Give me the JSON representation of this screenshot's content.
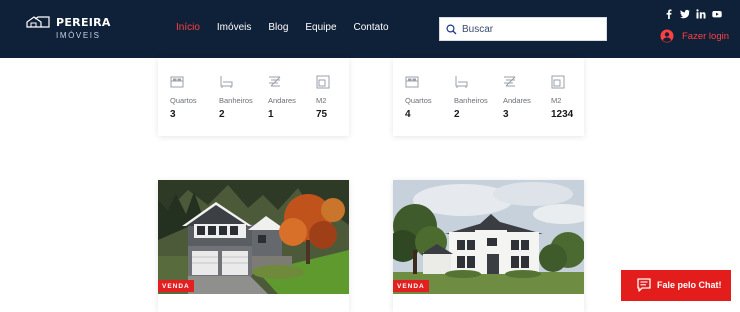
{
  "brand": {
    "name": "PEREIRA",
    "subtitle": "IMÓVEIS"
  },
  "nav": [
    {
      "label": "Início",
      "active": true
    },
    {
      "label": "Imóveis",
      "active": false
    },
    {
      "label": "Blog",
      "active": false
    },
    {
      "label": "Equipe",
      "active": false
    },
    {
      "label": "Contato",
      "active": false
    }
  ],
  "search": {
    "placeholder": "Buscar",
    "value": ""
  },
  "social": [
    "facebook-icon",
    "twitter-icon",
    "linkedin-icon",
    "youtube-icon"
  ],
  "login": {
    "label": "Fazer login",
    "icon": "user-icon"
  },
  "colors": {
    "header_bg": "#0f2039",
    "accent": "#ff4040",
    "badge": "#e32020",
    "chat": "#e31c1c"
  },
  "listings_top": [
    {
      "features": [
        {
          "label": "Quartos",
          "value": "3",
          "icon": "bed-icon"
        },
        {
          "label": "Banheiros",
          "value": "2",
          "icon": "bathtub-icon"
        },
        {
          "label": "Andares",
          "value": "1",
          "icon": "stairs-icon"
        },
        {
          "label": "M2",
          "value": "75",
          "icon": "area-icon"
        }
      ]
    },
    {
      "features": [
        {
          "label": "Quartos",
          "value": "4",
          "icon": "bed-icon"
        },
        {
          "label": "Banheiros",
          "value": "2",
          "icon": "bathtub-icon"
        },
        {
          "label": "Andares",
          "value": "3",
          "icon": "stairs-icon"
        },
        {
          "label": "M2",
          "value": "1234",
          "icon": "area-icon"
        }
      ]
    }
  ],
  "listings_bottom": [
    {
      "badge": "VENDA",
      "photo": "house-photo-craftsman"
    },
    {
      "badge": "VENDA",
      "photo": "house-photo-colonial"
    }
  ],
  "chat": {
    "label": "Fale pelo Chat!",
    "icon": "chat-icon"
  }
}
